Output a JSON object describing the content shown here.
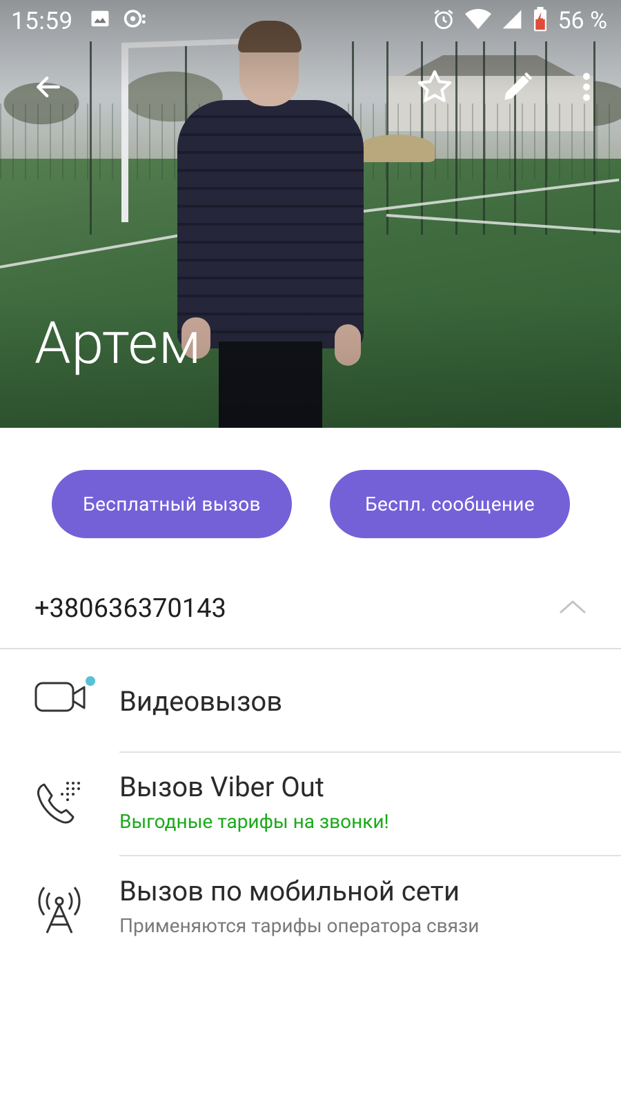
{
  "status_bar": {
    "time": "15:59",
    "battery_percent": "56 %",
    "icons_left": [
      "image-icon",
      "viber-notification-icon"
    ],
    "icons_right": [
      "alarm-icon",
      "wifi-icon",
      "signal-icon",
      "battery-charging-icon"
    ]
  },
  "toolbar": {
    "back_icon": "arrow-left-icon",
    "favorite_icon": "star-outline-icon",
    "edit_icon": "pencil-icon",
    "more_icon": "more-vertical-icon"
  },
  "contact": {
    "name": "Артем",
    "phone": "+380636370143"
  },
  "actions": {
    "free_call": "Бесплатный вызов",
    "free_message": "Беспл. сообщение"
  },
  "options": [
    {
      "title": "Видеовызов",
      "subtitle": "",
      "icon": "video-camera-icon"
    },
    {
      "title": "Вызов Viber Out",
      "subtitle": "Выгодные тарифы на звонки!",
      "icon": "phone-dialpad-icon"
    },
    {
      "title": "Вызов по мобильной сети",
      "subtitle": "Применяются тарифы оператора связи",
      "icon": "cell-tower-icon"
    }
  ],
  "colors": {
    "accent": "#7461d8",
    "viber_out_subtitle": "#1aaa1a",
    "muted_subtitle": "#7a7a7a",
    "badge_dot": "#59c1d6"
  }
}
